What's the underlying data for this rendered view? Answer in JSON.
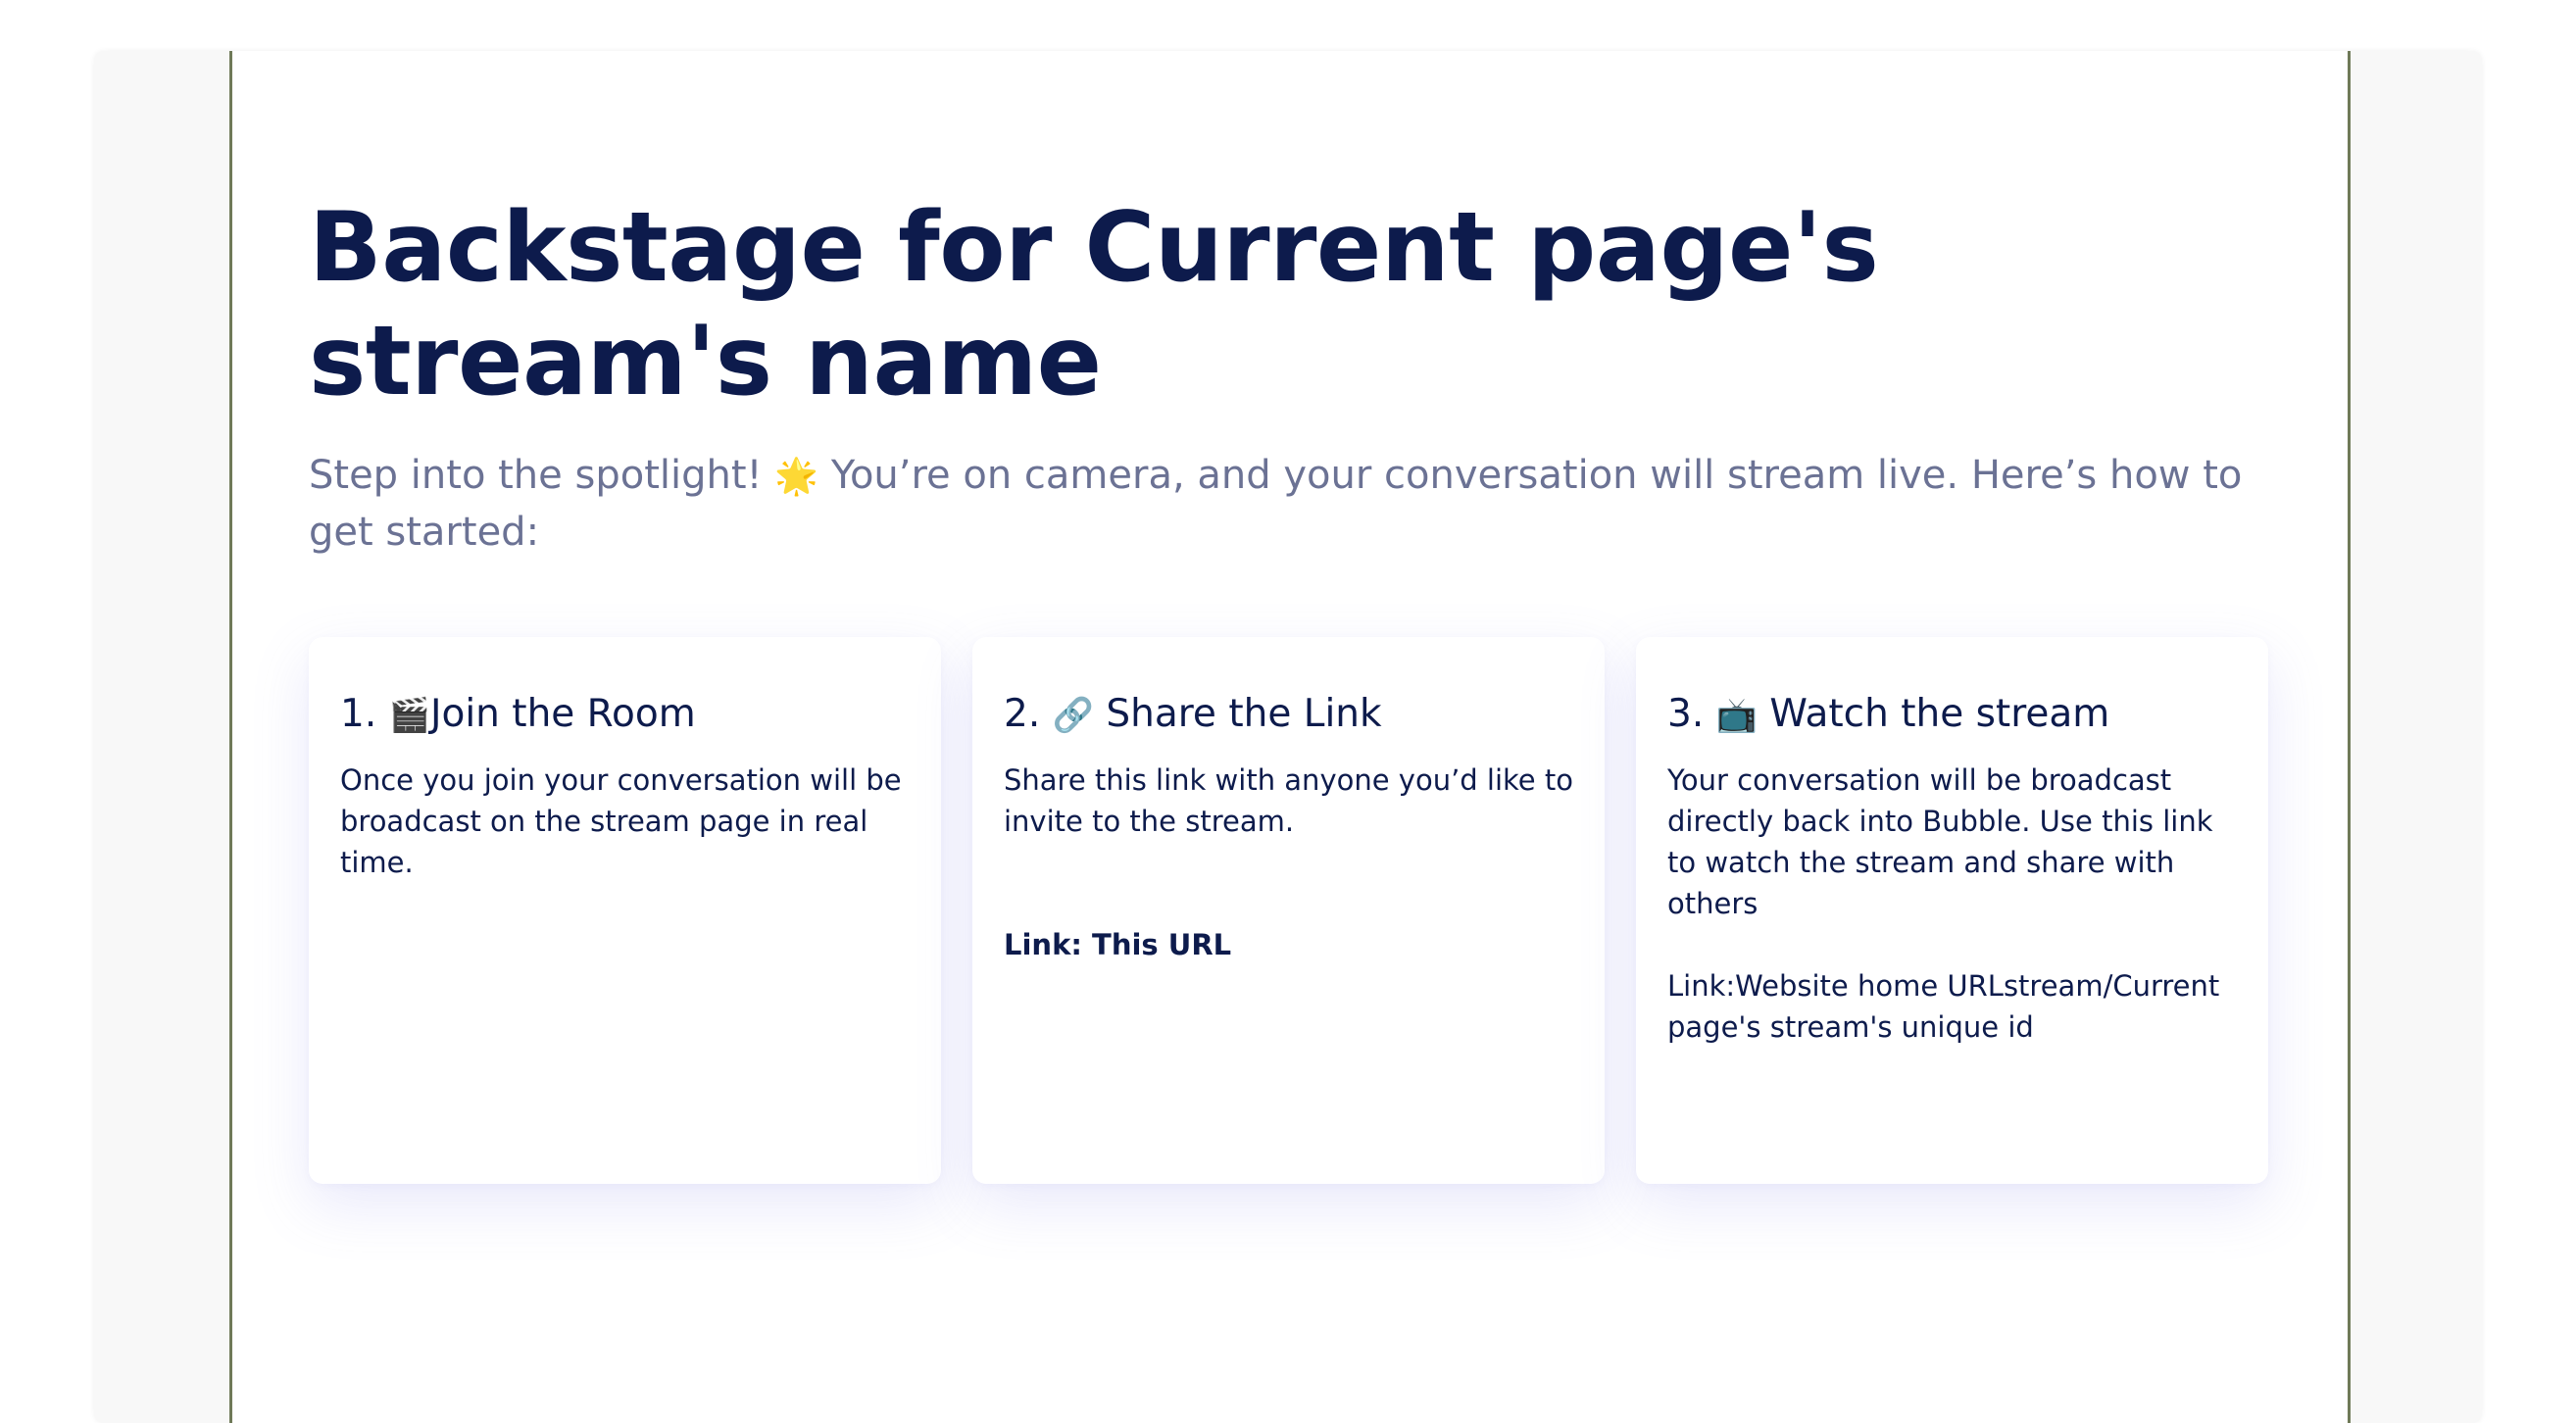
{
  "page": {
    "title": "Backstage for Current page's stream's name",
    "subtitle_before": "Step into the spotlight!",
    "subtitle_icon": "🌟",
    "subtitle_after": "You’re on camera, and your conversation will stream live. Here’s how to get started:"
  },
  "cards": [
    {
      "number": "1.",
      "icon": "🎬",
      "title": "Join the Room",
      "body": "Once you join your conversation will be broadcast on the stream page in real time."
    },
    {
      "number": "2.",
      "icon": "🔗",
      "title": "Share the Link",
      "body": "Share this link with anyone you’d like to invite to the stream.",
      "link": "Link: This URL"
    },
    {
      "number": "3.",
      "icon": "📺",
      "title": "Watch the stream",
      "body": "Your conversation will be broadcast directly back into Bubble. Use this link to watch the stream and share with others",
      "link": "Link:Website home URLstream/Current page's stream's unique id"
    }
  ],
  "colors": {
    "heading": "#0d1b4c",
    "subtitle": "#6b7294",
    "page_background": "#ffffff",
    "frame_background": "#f8f8f8",
    "panel_border": "#6f7a58"
  }
}
